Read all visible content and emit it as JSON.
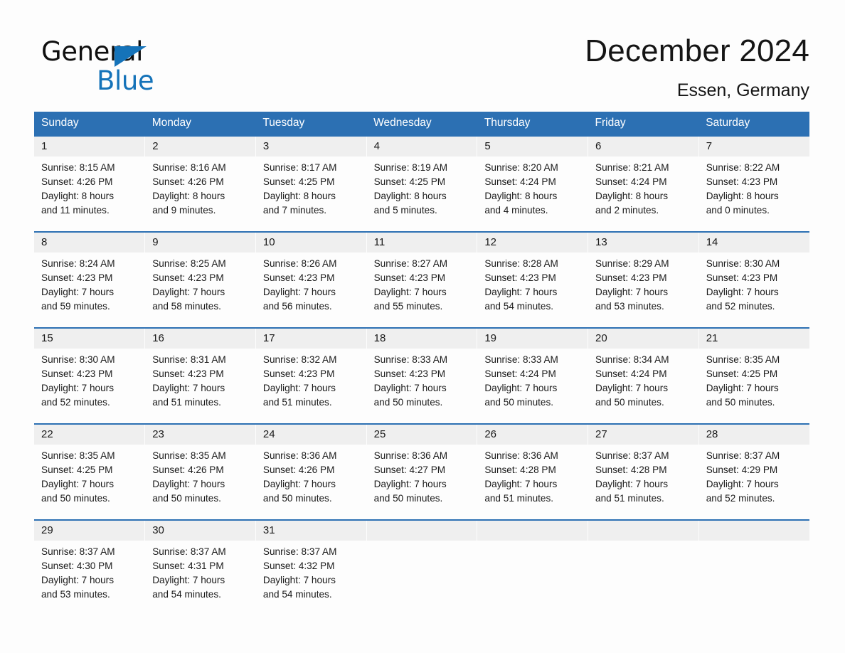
{
  "brand": {
    "word_one": "General",
    "word_two": "Blue",
    "accent_color": "#1573b9"
  },
  "header": {
    "title": "December 2024",
    "location": "Essen, Germany",
    "header_bg_color": "#2c70b3",
    "daynum_bg_color": "#efefef"
  },
  "weekdays": [
    "Sunday",
    "Monday",
    "Tuesday",
    "Wednesday",
    "Thursday",
    "Friday",
    "Saturday"
  ],
  "weeks": [
    [
      {
        "day": "1",
        "sunrise": "Sunrise: 8:15 AM",
        "sunset": "Sunset: 4:26 PM",
        "daylight_line1": "Daylight: 8 hours",
        "daylight_line2": "and 11 minutes."
      },
      {
        "day": "2",
        "sunrise": "Sunrise: 8:16 AM",
        "sunset": "Sunset: 4:26 PM",
        "daylight_line1": "Daylight: 8 hours",
        "daylight_line2": "and 9 minutes."
      },
      {
        "day": "3",
        "sunrise": "Sunrise: 8:17 AM",
        "sunset": "Sunset: 4:25 PM",
        "daylight_line1": "Daylight: 8 hours",
        "daylight_line2": "and 7 minutes."
      },
      {
        "day": "4",
        "sunrise": "Sunrise: 8:19 AM",
        "sunset": "Sunset: 4:25 PM",
        "daylight_line1": "Daylight: 8 hours",
        "daylight_line2": "and 5 minutes."
      },
      {
        "day": "5",
        "sunrise": "Sunrise: 8:20 AM",
        "sunset": "Sunset: 4:24 PM",
        "daylight_line1": "Daylight: 8 hours",
        "daylight_line2": "and 4 minutes."
      },
      {
        "day": "6",
        "sunrise": "Sunrise: 8:21 AM",
        "sunset": "Sunset: 4:24 PM",
        "daylight_line1": "Daylight: 8 hours",
        "daylight_line2": "and 2 minutes."
      },
      {
        "day": "7",
        "sunrise": "Sunrise: 8:22 AM",
        "sunset": "Sunset: 4:23 PM",
        "daylight_line1": "Daylight: 8 hours",
        "daylight_line2": "and 0 minutes."
      }
    ],
    [
      {
        "day": "8",
        "sunrise": "Sunrise: 8:24 AM",
        "sunset": "Sunset: 4:23 PM",
        "daylight_line1": "Daylight: 7 hours",
        "daylight_line2": "and 59 minutes."
      },
      {
        "day": "9",
        "sunrise": "Sunrise: 8:25 AM",
        "sunset": "Sunset: 4:23 PM",
        "daylight_line1": "Daylight: 7 hours",
        "daylight_line2": "and 58 minutes."
      },
      {
        "day": "10",
        "sunrise": "Sunrise: 8:26 AM",
        "sunset": "Sunset: 4:23 PM",
        "daylight_line1": "Daylight: 7 hours",
        "daylight_line2": "and 56 minutes."
      },
      {
        "day": "11",
        "sunrise": "Sunrise: 8:27 AM",
        "sunset": "Sunset: 4:23 PM",
        "daylight_line1": "Daylight: 7 hours",
        "daylight_line2": "and 55 minutes."
      },
      {
        "day": "12",
        "sunrise": "Sunrise: 8:28 AM",
        "sunset": "Sunset: 4:23 PM",
        "daylight_line1": "Daylight: 7 hours",
        "daylight_line2": "and 54 minutes."
      },
      {
        "day": "13",
        "sunrise": "Sunrise: 8:29 AM",
        "sunset": "Sunset: 4:23 PM",
        "daylight_line1": "Daylight: 7 hours",
        "daylight_line2": "and 53 minutes."
      },
      {
        "day": "14",
        "sunrise": "Sunrise: 8:30 AM",
        "sunset": "Sunset: 4:23 PM",
        "daylight_line1": "Daylight: 7 hours",
        "daylight_line2": "and 52 minutes."
      }
    ],
    [
      {
        "day": "15",
        "sunrise": "Sunrise: 8:30 AM",
        "sunset": "Sunset: 4:23 PM",
        "daylight_line1": "Daylight: 7 hours",
        "daylight_line2": "and 52 minutes."
      },
      {
        "day": "16",
        "sunrise": "Sunrise: 8:31 AM",
        "sunset": "Sunset: 4:23 PM",
        "daylight_line1": "Daylight: 7 hours",
        "daylight_line2": "and 51 minutes."
      },
      {
        "day": "17",
        "sunrise": "Sunrise: 8:32 AM",
        "sunset": "Sunset: 4:23 PM",
        "daylight_line1": "Daylight: 7 hours",
        "daylight_line2": "and 51 minutes."
      },
      {
        "day": "18",
        "sunrise": "Sunrise: 8:33 AM",
        "sunset": "Sunset: 4:23 PM",
        "daylight_line1": "Daylight: 7 hours",
        "daylight_line2": "and 50 minutes."
      },
      {
        "day": "19",
        "sunrise": "Sunrise: 8:33 AM",
        "sunset": "Sunset: 4:24 PM",
        "daylight_line1": "Daylight: 7 hours",
        "daylight_line2": "and 50 minutes."
      },
      {
        "day": "20",
        "sunrise": "Sunrise: 8:34 AM",
        "sunset": "Sunset: 4:24 PM",
        "daylight_line1": "Daylight: 7 hours",
        "daylight_line2": "and 50 minutes."
      },
      {
        "day": "21",
        "sunrise": "Sunrise: 8:35 AM",
        "sunset": "Sunset: 4:25 PM",
        "daylight_line1": "Daylight: 7 hours",
        "daylight_line2": "and 50 minutes."
      }
    ],
    [
      {
        "day": "22",
        "sunrise": "Sunrise: 8:35 AM",
        "sunset": "Sunset: 4:25 PM",
        "daylight_line1": "Daylight: 7 hours",
        "daylight_line2": "and 50 minutes."
      },
      {
        "day": "23",
        "sunrise": "Sunrise: 8:35 AM",
        "sunset": "Sunset: 4:26 PM",
        "daylight_line1": "Daylight: 7 hours",
        "daylight_line2": "and 50 minutes."
      },
      {
        "day": "24",
        "sunrise": "Sunrise: 8:36 AM",
        "sunset": "Sunset: 4:26 PM",
        "daylight_line1": "Daylight: 7 hours",
        "daylight_line2": "and 50 minutes."
      },
      {
        "day": "25",
        "sunrise": "Sunrise: 8:36 AM",
        "sunset": "Sunset: 4:27 PM",
        "daylight_line1": "Daylight: 7 hours",
        "daylight_line2": "and 50 minutes."
      },
      {
        "day": "26",
        "sunrise": "Sunrise: 8:36 AM",
        "sunset": "Sunset: 4:28 PM",
        "daylight_line1": "Daylight: 7 hours",
        "daylight_line2": "and 51 minutes."
      },
      {
        "day": "27",
        "sunrise": "Sunrise: 8:37 AM",
        "sunset": "Sunset: 4:28 PM",
        "daylight_line1": "Daylight: 7 hours",
        "daylight_line2": "and 51 minutes."
      },
      {
        "day": "28",
        "sunrise": "Sunrise: 8:37 AM",
        "sunset": "Sunset: 4:29 PM",
        "daylight_line1": "Daylight: 7 hours",
        "daylight_line2": "and 52 minutes."
      }
    ],
    [
      {
        "day": "29",
        "sunrise": "Sunrise: 8:37 AM",
        "sunset": "Sunset: 4:30 PM",
        "daylight_line1": "Daylight: 7 hours",
        "daylight_line2": "and 53 minutes."
      },
      {
        "day": "30",
        "sunrise": "Sunrise: 8:37 AM",
        "sunset": "Sunset: 4:31 PM",
        "daylight_line1": "Daylight: 7 hours",
        "daylight_line2": "and 54 minutes."
      },
      {
        "day": "31",
        "sunrise": "Sunrise: 8:37 AM",
        "sunset": "Sunset: 4:32 PM",
        "daylight_line1": "Daylight: 7 hours",
        "daylight_line2": "and 54 minutes."
      },
      {
        "day": "",
        "sunrise": "",
        "sunset": "",
        "daylight_line1": "",
        "daylight_line2": ""
      },
      {
        "day": "",
        "sunrise": "",
        "sunset": "",
        "daylight_line1": "",
        "daylight_line2": ""
      },
      {
        "day": "",
        "sunrise": "",
        "sunset": "",
        "daylight_line1": "",
        "daylight_line2": ""
      },
      {
        "day": "",
        "sunrise": "",
        "sunset": "",
        "daylight_line1": "",
        "daylight_line2": ""
      }
    ]
  ]
}
